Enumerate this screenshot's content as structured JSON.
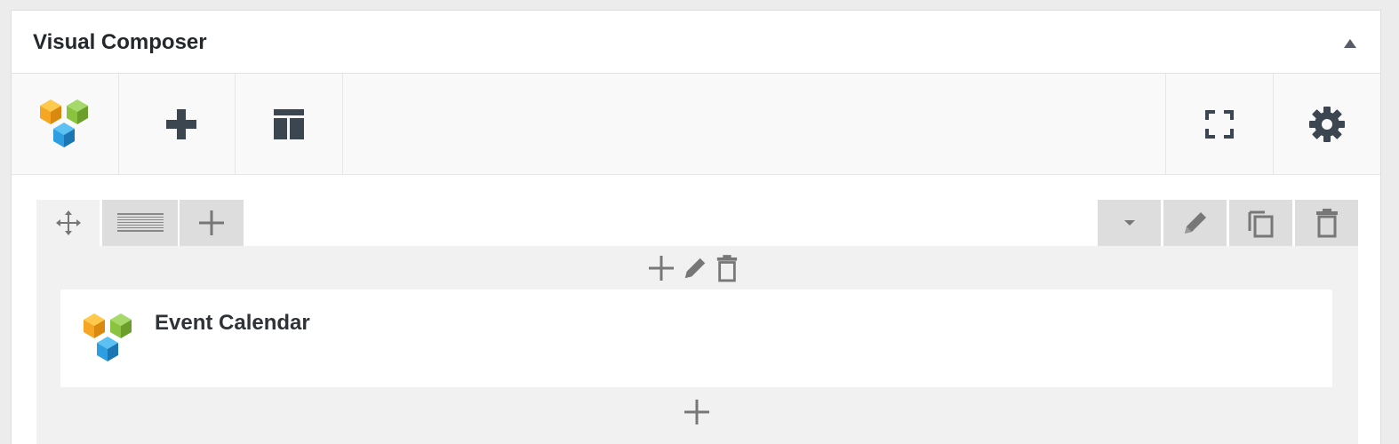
{
  "panel": {
    "title": "Visual Composer",
    "collapse_icon": "triangle-up-icon"
  },
  "toolbar": {
    "logo_icon": "vc-logo-icon",
    "add_element_icon": "plus-icon",
    "templates_icon": "layout-template-icon",
    "fullscreen_icon": "fullscreen-icon",
    "settings_icon": "gear-icon"
  },
  "row": {
    "tabs": [
      "move-icon",
      "column-layout-icon",
      "plus-icon"
    ],
    "controls": [
      "caret-down-icon",
      "pencil-icon",
      "copy-icon",
      "trash-icon"
    ],
    "column_controls": [
      "plus-icon",
      "pencil-icon",
      "trash-icon"
    ],
    "element": {
      "title": "Event Calendar",
      "icon": "vc-logo-icon"
    },
    "add_bottom_icon": "plus-icon"
  },
  "colors": {
    "dark_icon": "#3c4650",
    "grey_icon": "#777777",
    "logo_orange": "#f5a623",
    "logo_green": "#8ac43f",
    "logo_blue": "#2d9ee0"
  }
}
